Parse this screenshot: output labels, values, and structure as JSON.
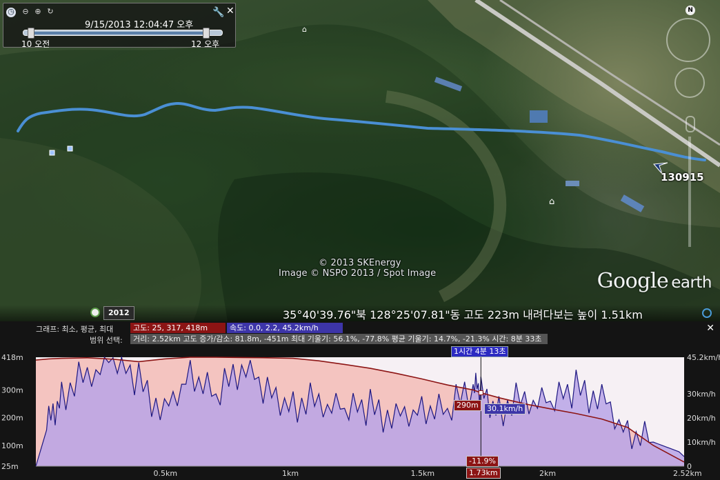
{
  "time_slider": {
    "datetime": "9/15/2013  12:04:47 오후",
    "start_label": "10 오전",
    "end_label": "12 오후",
    "icons": [
      "clock-icon",
      "zoom-out-icon",
      "zoom-in-icon",
      "replay-icon",
      "wrench-icon",
      "close-icon"
    ]
  },
  "map": {
    "track_label": "130915",
    "copyright_line1": "© 2013 SKEnergy",
    "copyright_line2": "Image © NSPO 2013 / Spot Image",
    "logo_google": "Google",
    "logo_earth": "earth",
    "track_color": "#4a8fd4"
  },
  "status_bar": {
    "year": "2012",
    "coords_text": "35°40'39.76\"북 128°25'07.81\"동 고도    223m    내려다보는 높이    1.51km"
  },
  "profile": {
    "graph_label": "그래프: 최소, 평균, 최대",
    "elevation_chip": "고도: 25, 317, 418m",
    "speed_chip": "속도: 0.0, 2.2, 45.2km/h",
    "range_label": "범위 선택:",
    "stats_chip": "거리: 2.52km 고도 증가/감소: 81.8m, -451m 최대 기울기: 56.1%, -77.8% 평균 기울기: 14.7%, -21.3% 시간: 8분 33초",
    "cursor_time": "1시간 4분 13초",
    "cursor_elevation": "290m",
    "cursor_speed": "30.1km/h",
    "cursor_grade": "-11.9%",
    "cursor_distance": "1.73km",
    "colors": {
      "elevation": "#8c1414",
      "speed": "#1c1680",
      "elevation_fill": "#f4c4c0",
      "speed_fill": "#b8a4e6"
    }
  },
  "chart_data": {
    "type": "area",
    "title": "",
    "x": [
      0,
      0.05,
      0.1,
      0.2,
      0.3,
      0.4,
      0.5,
      0.6,
      0.7,
      0.8,
      0.9,
      1.0,
      1.1,
      1.2,
      1.3,
      1.4,
      1.5,
      1.6,
      1.7,
      1.73,
      1.8,
      1.9,
      2.0,
      2.1,
      2.2,
      2.3,
      2.4,
      2.5,
      2.52
    ],
    "series": [
      {
        "axis": "left",
        "values": [
          408,
          412,
          414,
          416,
          411,
          402,
          412,
          418,
          418,
          417,
          416,
          414,
          405,
          392,
          378,
          360,
          340,
          318,
          300,
          290,
          272,
          250,
          232,
          215,
          195,
          165,
          100,
          50,
          40
        ]
      },
      {
        "axis": "right",
        "values": [
          0,
          18,
          30,
          38,
          44,
          35,
          22,
          40,
          28,
          42,
          30,
          26,
          27,
          23,
          24,
          20,
          25,
          22,
          34,
          30.1,
          24,
          28,
          26,
          32,
          28,
          15,
          10,
          6,
          4
        ]
      }
    ],
    "x_ticks": [
      "0.5km",
      "1km",
      "1.5km",
      "1.73km",
      "2km",
      "2.52km"
    ],
    "y_left_ticks": [
      "418m",
      "300m",
      "200m",
      "100m",
      "25m"
    ],
    "y_right_ticks": [
      "45.2km/h",
      "30km/h",
      "20km/h",
      "10km/h",
      "0"
    ],
    "ylim_left": [
      25,
      418
    ],
    "ylim_right": [
      0,
      45.2
    ],
    "xlim": [
      0,
      2.52
    ],
    "cursor_x": 1.73
  }
}
